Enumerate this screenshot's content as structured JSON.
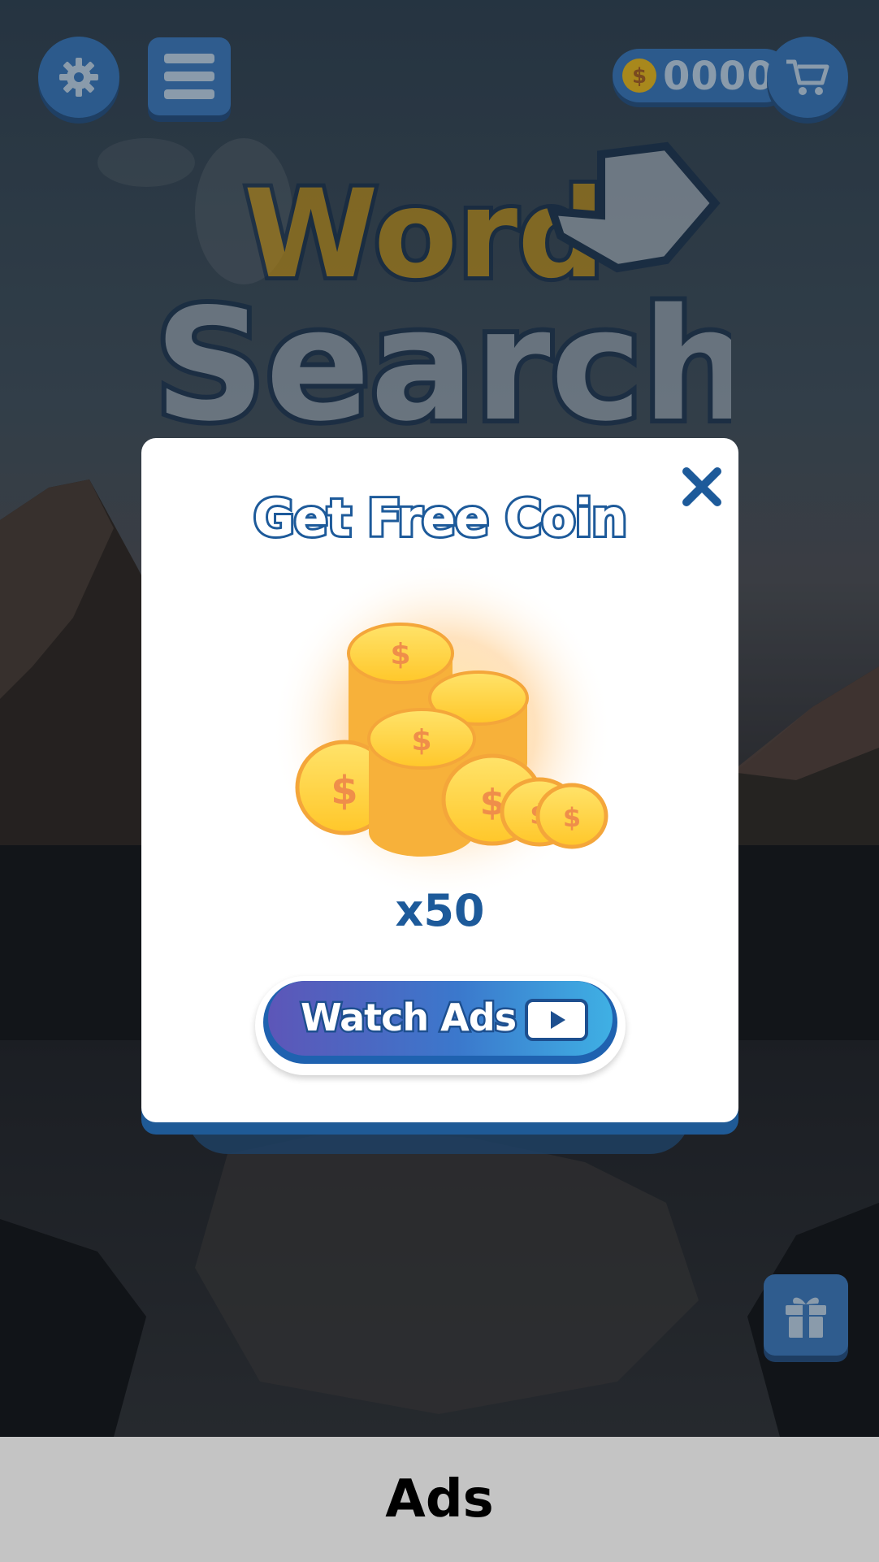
{
  "top_bar": {
    "settings_icon": "gear-icon",
    "menu_icon": "hamburger-icon",
    "coin_icon": "dollar-coin-icon",
    "coins": "0000",
    "shop_icon": "cart-icon"
  },
  "logo": {
    "line1": "Word",
    "line2": "Search"
  },
  "modal": {
    "title": "Get Free Coin",
    "close_icon": "close-x-icon",
    "reward_icon": "coin-stack-icon",
    "reward_amount": "x50",
    "watch_button": {
      "label": "Watch Ads",
      "icon": "play-icon"
    }
  },
  "gift_icon": "gift-icon",
  "ads_banner": {
    "label": "Ads"
  },
  "colors": {
    "primary_blue": "#1d5a9a",
    "button_blue": "#2c5a8c",
    "coin_gold": "#ffd23c",
    "banner_gray": "#c4c4c4"
  }
}
